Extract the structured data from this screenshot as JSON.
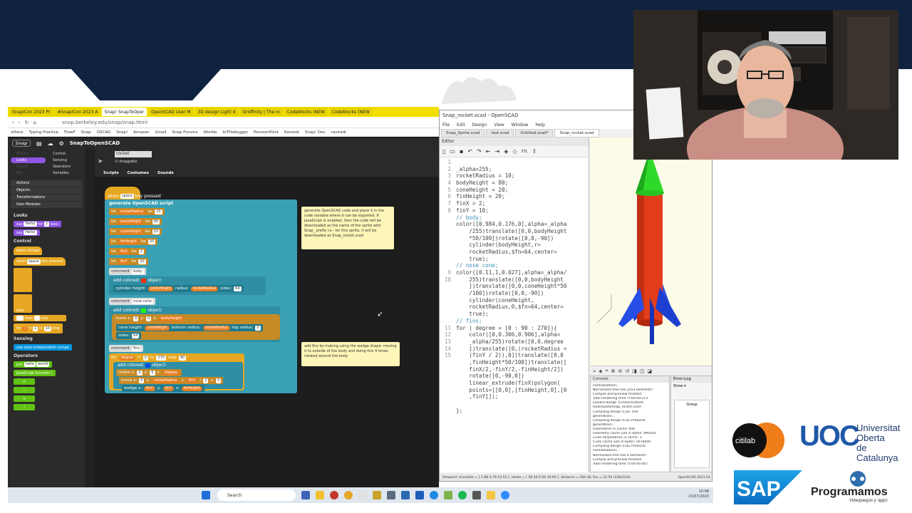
{
  "colors": {
    "banner": "#0f2341",
    "snap_looks": "#8f56e3",
    "snap_control": "#e6a822",
    "snap_sensing": "#0494dc",
    "snap_operators": "#62c213"
  },
  "browser": {
    "tabs": [
      "SnapICon 2023 Pr",
      "#SnapICon 2023 A",
      "Snap! SnapToOper",
      "OpenSCAD User M",
      "3D design Light d",
      "Gridfinity | The m",
      "Codeblocks (NEW",
      "Codeblocks (NEW"
    ],
    "url": "snap.berkeley.edu/snap/snap.html",
    "bookmarks": [
      "others",
      "Typing Practice",
      "FlowF",
      "Snap",
      "OSCAD",
      "Snap!",
      "Amazon",
      "Gmail",
      "Snap Forums",
      "Wordle",
      "IoTDebugger",
      "PensionPoint",
      "Komoot",
      "Snap! Dev",
      "raviradi"
    ]
  },
  "snap": {
    "project_title": "SnapToOpenSCAD",
    "sprite_name": "rocket",
    "draggable_label": "draggable",
    "pane_tabs": [
      "Scripts",
      "Costumes",
      "Sounds"
    ],
    "categories": [
      "Motion",
      "Control",
      "Looks",
      "Sensing",
      "Sound",
      "Operators",
      "Pen",
      "Variables"
    ],
    "other_categories": [
      "Actions",
      "Objects",
      "Transformations",
      "User Modules"
    ],
    "palette": {
      "looks_label": "Looks",
      "say_for": [
        "say",
        "Hello!",
        "for",
        "2",
        "secs"
      ],
      "say": [
        "say",
        "Hello!"
      ],
      "control_label": "Control",
      "when_clicked": "when clicked",
      "when_key": [
        "when",
        "space",
        "key pressed"
      ],
      "if_else": "else",
      "then_else": [
        "then",
        "else"
      ],
      "for_loop": [
        "for",
        "i",
        "=",
        "1",
        "to",
        "10",
        "step"
      ],
      "sensing_label": "Sensing",
      "case_independent": "use case-independent compa",
      "operators_label": "Operators",
      "join": [
        "join",
        "hello",
        "world"
      ],
      "js_function": "JavaScript function (",
      "ops": [
        "+",
        "−",
        "×",
        "/"
      ]
    },
    "script": {
      "hat": [
        "when",
        "space",
        "key pressed"
      ],
      "generate": "generate OpenSCAD script",
      "lets": [
        {
          "name": "rocketRadius",
          "value": "10"
        },
        {
          "name": "bodyHeight",
          "value": "80"
        },
        {
          "name": "coneHeight",
          "value": "20"
        },
        {
          "name": "finHeight",
          "value": "20"
        },
        {
          "name": "finX",
          "value": "2"
        },
        {
          "name": "finY",
          "value": "10"
        }
      ],
      "let_word": "let",
      "be_word": "be",
      "comment_word": "comment",
      "comment_body": "body",
      "add_colored": [
        "add colored:",
        "object:"
      ],
      "cylinder": [
        "cylinder height:",
        "bodyHeight",
        "radius:",
        "rocketRadius",
        "sides:",
        "64"
      ],
      "comment_nose": "nose cone",
      "move1": [
        "move x:",
        "0",
        "y:",
        "0",
        "z:",
        "bodyHeight"
      ],
      "cone": [
        "cone height:",
        "coneHeight",
        "bottom radius:",
        "rocketRadius",
        "top radius:",
        "0"
      ],
      "sides": [
        "sides:",
        "64"
      ],
      "comment_fins": "fins",
      "for_deg": [
        "for",
        "degree",
        "=",
        "0",
        "to",
        "270",
        "step",
        "90"
      ],
      "rotate": [
        "rotate x:",
        "0",
        "y:",
        "0",
        "z:",
        "degree"
      ],
      "move2": [
        "move x:",
        "0",
        "y:",
        "rocketRadius",
        "+",
        "finY",
        "/",
        "2",
        "z:",
        "0"
      ],
      "wedge": [
        "wedge x:",
        "finX",
        "y:",
        "finY",
        "z:",
        "finHeight"
      ]
    },
    "comment1": "generate OpenSCAD code and place it in the code variable where it can be exported. If JavaScript is enabled, then the code will be downloaded as the name of the sprite with Snap_ prefix i.e - for this sprite, it will be downloaded as Snap_rocket.scad",
    "comment2": "add fins by making using the wedge shape- moving it to outside of the body and doing this 4 times rotated around the body"
  },
  "openscad": {
    "title": "Snap_rocket.scad - OpenSCAD",
    "menu": [
      "File",
      "Edit",
      "Design",
      "View",
      "Window",
      "Help"
    ],
    "tabs": [
      "Snap_Sprite.scad",
      "test.scad",
      "Untitled.scad*",
      "Snap_rocket.scad"
    ],
    "editor_label": "Editor",
    "line_numbers": [
      "1",
      "2",
      "3",
      "4",
      "5",
      "6",
      "7",
      "8",
      "",
      "",
      "",
      "",
      "",
      "",
      "",
      "",
      "9",
      "10",
      "",
      "",
      "",
      "",
      "",
      "",
      "11",
      "12",
      "13",
      "14",
      "15",
      "",
      "",
      "",
      "",
      "",
      "",
      "",
      "",
      "",
      "",
      "16",
      "17"
    ],
    "code": [
      "",
      "_alpha=255;",
      "rocketRadius = 10;",
      "bodyHeight = 80;",
      "coneHeight = 20;",
      "finHeight = 20;",
      "finX = 2;",
      "finY = 10;",
      "// body;",
      "color([0.984,0.176,0],alpha=_alpha",
      "    /255)translate([0,0,bodyHeight",
      "    *50/100])rotate([0,0,-90])",
      "    cylinder(bodyHeight,r=",
      "    rocketRadius,$fn=64,center=",
      "    true);",
      "// nose cone;",
      "color([0.11,1,0.027],alpha=_alpha/",
      "    255)translate([0,0,bodyHeight",
      "    ])translate([0,0,coneHeight*50",
      "    /100])rotate([0,0,-90])",
      "    cylinder(coneHeight,",
      "    rocketRadius,0,$fn=64,center=",
      "    true);",
      "// fins;",
      "for ( degree = [0 : 90 : 270]){",
      "    color([0,0.306,0.906],alpha=",
      "    _alpha/255)rotate([0,0,degree",
      "    ])translate([0,(rocketRadius +",
      "    (finY / 2)),0])translate([0,0",
      "    ,finHeight*50/100])translate([",
      "    finX/2,-finY/2,-finHeight/2])",
      "    rotate([0,-90,0])",
      "    linear_extrude(finX)polygon(",
      "    points=[[0,0],[finHeight,0],[0",
      "    ,finY]]);",
      "",
      "};"
    ],
    "console_label": "Console",
    "console_lines": [
      "normalization)...",
      "Normalized tree has 2553 elements!",
      "Compile and preview finished.",
      "Total rendering time: 0:00:00.213",
      "Loaded design 'D:/Users/steve/",
      "Downloads/Snap_rocket.scad'.",
      "Compiling design (CSG Tree",
      "generation)...",
      "Compiling design (CSG Products",
      "generation)...",
      "Geometries in cache: 606",
      "Geometry cache size in bytes: 999240",
      "CGAL Polyhedrons in cache: 1",
      "CGAL cache size in bytes: 5078400",
      "Compiling design (CSG Products",
      "normalization)...",
      "Normalized tree has 6 elements!",
      "Compile and preview finished.",
      "Total rendering time: 0:00:00.007"
    ],
    "errorlog_label": "Error-Log",
    "errorlog_show": "Show",
    "errorlog_group": "Group",
    "viewport_status": "Viewport: translate = [ 1.88 4.79 53.53 ], rotate = [ 56.40 0.00 30.60 ], distance = 294.46, fov = 22.50 (336x514)",
    "version": "OpenSCAD 2021.01"
  },
  "taskbar": {
    "search_label": "Search",
    "time": "10:08",
    "date": "21/07/2023"
  },
  "logos": {
    "citilab": "citilab",
    "uoc_mark": "UOC",
    "uoc_text": [
      "Universitat",
      "Oberta",
      "de Catalunya"
    ],
    "sap": "SAP",
    "programamos": "Programamos",
    "programamos_sub": "Videojuegos y 'apps'"
  }
}
